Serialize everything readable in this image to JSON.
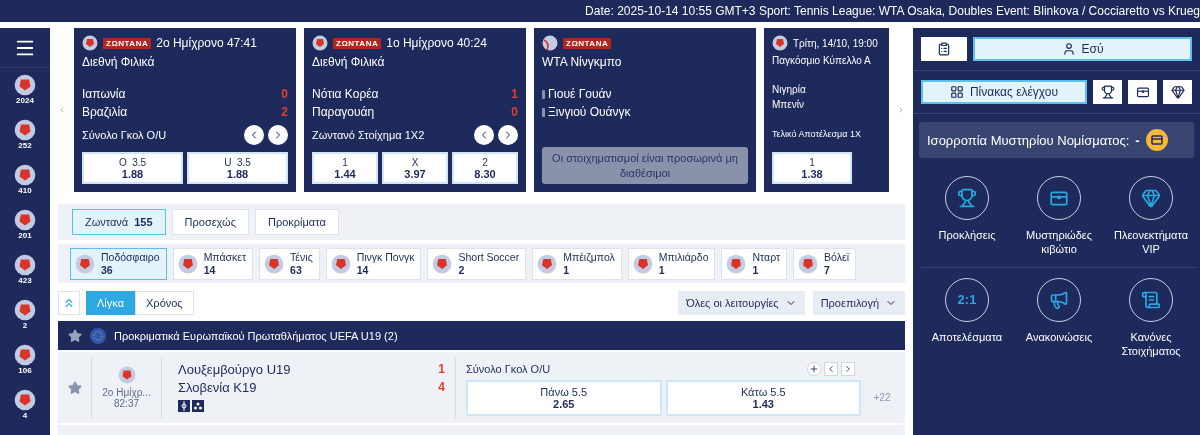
{
  "top_bar": {
    "text": "Date: 2025-10-14 10:55 GMT+3 Sport: Tennis League: WTA Osaka, Doubles Event: Blinkova / Cocciaretto vs Krueg"
  },
  "sidebar": {
    "items": [
      {
        "count": "2024"
      },
      {
        "count": "252"
      },
      {
        "count": "410"
      },
      {
        "count": "201"
      },
      {
        "count": "423"
      },
      {
        "count": "2"
      },
      {
        "count": "106"
      },
      {
        "count": "4"
      }
    ]
  },
  "carousel": {
    "cards": [
      {
        "kind": "football",
        "live_badge": "ΖΩΝΤΑΝΑ",
        "period": "2ο Ημίχρονο 47:41",
        "league": "Διεθνή Φιλικά",
        "teams": [
          {
            "name": "Ιαπωνία",
            "score": "0"
          },
          {
            "name": "Βραζιλία",
            "score": "2"
          }
        ],
        "market": "Σύνολο Γκολ O/U",
        "odds": [
          {
            "label": "O  3.5",
            "value": "1.88"
          },
          {
            "label": "U  3.5",
            "value": "1.88"
          }
        ]
      },
      {
        "kind": "football",
        "live_badge": "ΖΩΝΤΑΝΑ",
        "period": "1ο Ημίχρονο 40:24",
        "league": "Διεθνή Φιλικά",
        "teams": [
          {
            "name": "Νότια Κορέα",
            "score": "1"
          },
          {
            "name": "Παραγουάη",
            "score": "0"
          }
        ],
        "market": "Ζωντανό Στοίχημα 1X2",
        "odds": [
          {
            "label": "1",
            "value": "1.44"
          },
          {
            "label": "X",
            "value": "3.97"
          },
          {
            "label": "2",
            "value": "8.30"
          }
        ]
      },
      {
        "kind": "tennis",
        "live_badge": "ΖΩΝΤΑΝΑ",
        "league": "WTA Νίνγκμπο",
        "teams": [
          {
            "name": "Γιουέ Γουάν"
          },
          {
            "name": "Ξινγιού Ουάνγκ"
          }
        ],
        "message": "Οι στοιχηματισμοί είναι προσωρινά μη διαθέσιμοι"
      },
      {
        "kind": "football",
        "period": "Τρίτη, 14/10, 19:00",
        "league": "Παγκόσμιο Κύπελλο Α",
        "teams": [
          {
            "name": "Νιγηρία"
          },
          {
            "name": "Μπενίν"
          }
        ],
        "market": "Τελικό Αποτέλεσμα 1Χ",
        "odds": [
          {
            "label": "1",
            "value": "1.38"
          }
        ]
      }
    ]
  },
  "tabs": [
    {
      "label": "Ζωντανά",
      "count": "155",
      "selected": true
    },
    {
      "label": "Προσεχώς",
      "selected": false
    },
    {
      "label": "Προκρίματα",
      "selected": false
    }
  ],
  "sports": [
    {
      "name": "Ποδόσφαιρο",
      "count": "36",
      "selected": true
    },
    {
      "name": "Μπάσκετ",
      "count": "14",
      "selected": false
    },
    {
      "name": "Τένις",
      "count": "63",
      "selected": false
    },
    {
      "name": "Πινγκ Πονγκ",
      "count": "14",
      "selected": false
    },
    {
      "name": "Short Soccer",
      "count": "2",
      "selected": false
    },
    {
      "name": "Μπέιζμπολ",
      "count": "1",
      "selected": false
    },
    {
      "name": "Μπιλιάρδο",
      "count": "1",
      "selected": false
    },
    {
      "name": "Νταρτ",
      "count": "1",
      "selected": false
    },
    {
      "name": "Βόλεϊ",
      "count": "7",
      "selected": false
    }
  ],
  "view_toggle": [
    {
      "label": "Λίγκα",
      "selected": true
    },
    {
      "label": "Χρόνος",
      "selected": false
    }
  ],
  "dropdowns": [
    "Όλες οι λειτουργίες",
    "Προεπιλογή"
  ],
  "league": {
    "name": "Προκριματικά Ευρωπαϊκού Πρωταθλήματος UEFA U19 (2)",
    "matches": [
      {
        "period": "2ο Ημίχρ...",
        "clock": "82:37",
        "teams": [
          {
            "name": "Λουξεμβούργο U19",
            "score": "1"
          },
          {
            "name": "Σλοβενία K19",
            "score": "4"
          }
        ],
        "market": "Σύνολο Γκολ O/U",
        "odds": [
          {
            "label": "Πάνω",
            "line": "5.5",
            "value": "2.65"
          },
          {
            "label": "Κάτω",
            "line": "5.5",
            "value": "1.43"
          }
        ],
        "more": "+22"
      }
    ]
  },
  "account": {
    "user_button": "Εσύ",
    "dashboard_button": "Πίνακας ελέγχου",
    "balance": {
      "label": "Ισορροπία Μυστηρίου Νομίσματος:",
      "value": "-"
    },
    "shortcuts": [
      {
        "kind": "trophy",
        "label": "Προκλήσεις"
      },
      {
        "kind": "chest",
        "label": "Μυστηριώδες κιβώτιο"
      },
      {
        "kind": "diamond",
        "label": "Πλεονεκτήματα VIP"
      },
      {
        "kind": "score",
        "icon_text": "2:1",
        "label": "Αποτελέσματα"
      },
      {
        "kind": "megaphone",
        "label": "Ανακοινώσεις"
      },
      {
        "kind": "scroll",
        "label": "Κανόνες Στοιχήματος"
      }
    ]
  }
}
